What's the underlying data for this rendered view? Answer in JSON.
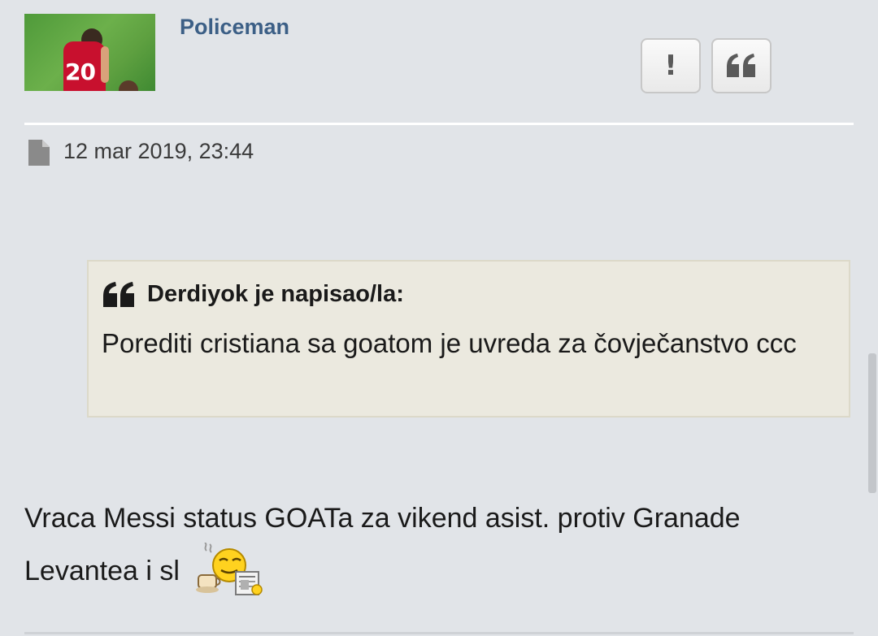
{
  "post": {
    "username": "Policeman",
    "date": "12 mar 2019, 23:44",
    "avatar_number": "20",
    "actions": {
      "report_label": "!",
      "quote_icon": "quote-icon"
    },
    "quote": {
      "author": "Derdiyok je napisao/la:",
      "text": "Porediti cristiana sa goatom je uvreda za čovječanstvo ccc"
    },
    "body_text": "Vraca Messi status GOATa za vikend asist. protiv Granade Levantea i sl",
    "smiley_icon": "coffee-reading-smiley-icon"
  },
  "colors": {
    "background": "#e1e4e8",
    "username": "#3c5f86",
    "quote_background": "#ebe9df"
  }
}
